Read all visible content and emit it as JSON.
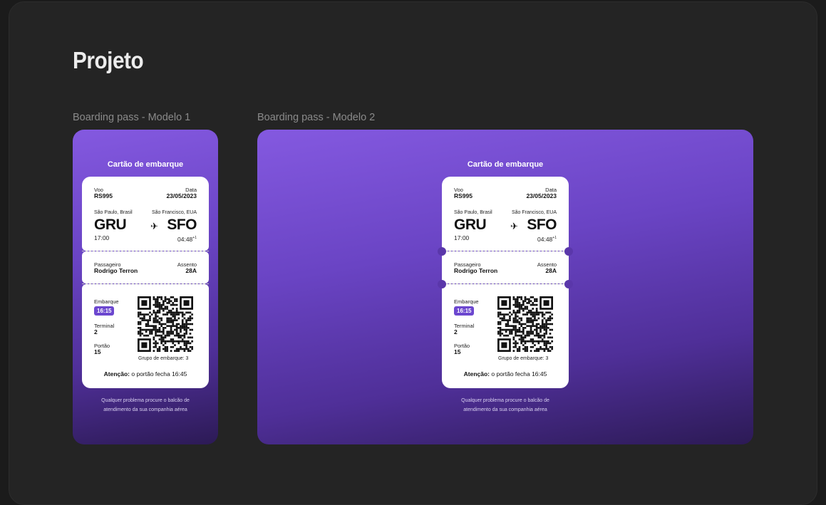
{
  "page": {
    "title": "Projeto"
  },
  "sections": [
    {
      "label": "Boarding pass - Modelo 1"
    },
    {
      "label": "Boarding pass - Modelo 2"
    }
  ],
  "pass": {
    "title": "Cartão de embarque",
    "flight_label": "Voo",
    "flight": "RS995",
    "date_label": "Data",
    "date": "23/05/2023",
    "origin_city": "São Paulo, Brasil",
    "origin_code": "GRU",
    "origin_time": "17:00",
    "dest_city": "São Francisco, EUA",
    "dest_code": "SFO",
    "dest_time": "04:48",
    "dest_time_sup": "+1",
    "passenger_label": "Passageiro",
    "passenger": "Rodrigo Terron",
    "seat_label": "Assento",
    "seat": "28A",
    "boarding_label": "Embarque",
    "boarding_time": "16:15",
    "terminal_label": "Terminal",
    "terminal": "2",
    "gate_label": "Portão",
    "gate": "15",
    "group": "Grupo de embarque: 3",
    "attention_bold": "Atenção:",
    "attention_text": " o portão fecha 16:45",
    "footnote_1": "Qualquer problema procure o balcão de",
    "footnote_2": "atendimento da sua companhia aérea"
  },
  "colors": {
    "panel_top": "#8459e0",
    "panel_bottom": "#2c1a55",
    "badge": "#6c47cf"
  },
  "icons": {
    "plane": "airplane-icon",
    "qr": "qr-code-icon"
  }
}
